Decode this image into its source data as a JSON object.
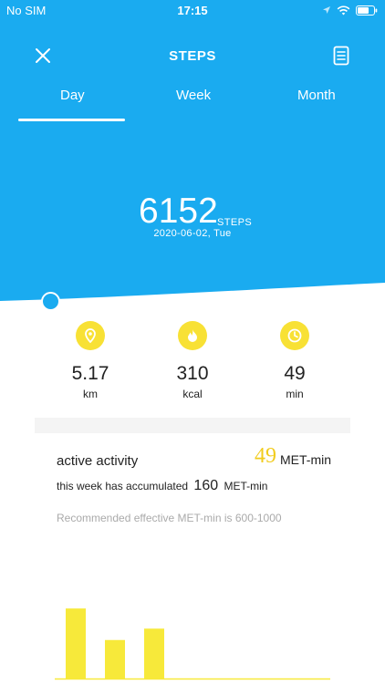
{
  "status_bar": {
    "carrier": "No SIM",
    "time": "17:15"
  },
  "nav": {
    "title": "STEPS",
    "left_icon": "close-icon",
    "right_icon": "report-icon"
  },
  "tabs": [
    {
      "label": "Day",
      "active": true
    },
    {
      "label": "Week",
      "active": false
    },
    {
      "label": "Month",
      "active": false
    }
  ],
  "summary": {
    "steps": "6152",
    "unit": "STEPS",
    "date": "2020-06-02, Tue"
  },
  "metrics": [
    {
      "icon": "location-pin-icon",
      "value": "5.17",
      "unit": "km"
    },
    {
      "icon": "flame-icon",
      "value": "310",
      "unit": "kcal"
    },
    {
      "icon": "clock-icon",
      "value": "49",
      "unit": "min"
    }
  ],
  "activity": {
    "title": "active activity",
    "met_value": "49",
    "met_unit": "MET-min",
    "accum_prefix": "this week has accumulated",
    "accum_value": "160",
    "accum_unit": "MET-min",
    "recommendation": "Recommended effective MET-min is 600-1000"
  },
  "colors": {
    "header_blue": "#1aabf0",
    "accent_yellow": "#f8e135",
    "bar_yellow": "#f7e93a"
  },
  "chart_data": {
    "type": "bar",
    "categories": [
      "",
      "",
      ""
    ],
    "values": [
      80,
      44,
      57
    ],
    "ylim": [
      0,
      100
    ],
    "grid": false
  }
}
